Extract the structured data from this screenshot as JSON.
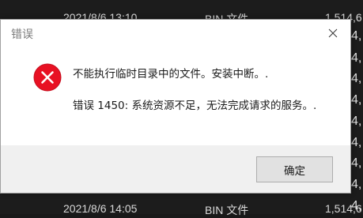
{
  "background": {
    "rows": [
      {
        "date": "2021/8/6 13:10",
        "type": "BIN 文件",
        "size": "1,514,6"
      },
      {
        "date": "2021/8/6 14:05",
        "type": "BIN 文件",
        "size": "1,514,6"
      }
    ],
    "right_col_values": [
      "4,",
      "4,",
      "4,",
      "4,",
      "4,",
      "4,",
      "4,",
      "4,",
      "4,"
    ]
  },
  "dialog": {
    "title": "错误",
    "message_line1": "不能执行临时目录中的文件。安装中断。.",
    "message_line2": "错误 1450: 系统资源不足，无法完成请求的服务。.",
    "ok_label": "确定",
    "icon": "error-icon",
    "colors": {
      "error_red": "#e81123",
      "title_text": "#7a7a7a"
    }
  }
}
